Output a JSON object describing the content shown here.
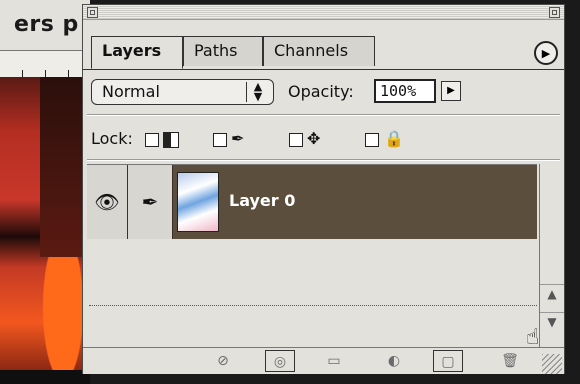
{
  "document": {
    "title_fragment": "ers p"
  },
  "palette": {
    "tabs": [
      {
        "label": "Layers",
        "active": true
      },
      {
        "label": "Paths",
        "active": false
      },
      {
        "label": "Channels",
        "active": false
      }
    ],
    "menu_icon": "triangle-right-icon",
    "blend_mode": {
      "value": "Normal"
    },
    "opacity": {
      "label": "Opacity:",
      "value": "100%"
    },
    "lock": {
      "label": "Lock:"
    },
    "layers": [
      {
        "name": "Layer 0",
        "visible": true,
        "selected": true
      }
    ],
    "toolbar_icons": [
      "layer-style-icon",
      "layer-mask-icon",
      "new-set-icon",
      "adjustment-layer-icon",
      "new-layer-icon",
      "trash-icon"
    ],
    "colors": {
      "selected_row": "#5b4e3d",
      "panel": "#e3e1dc"
    }
  }
}
